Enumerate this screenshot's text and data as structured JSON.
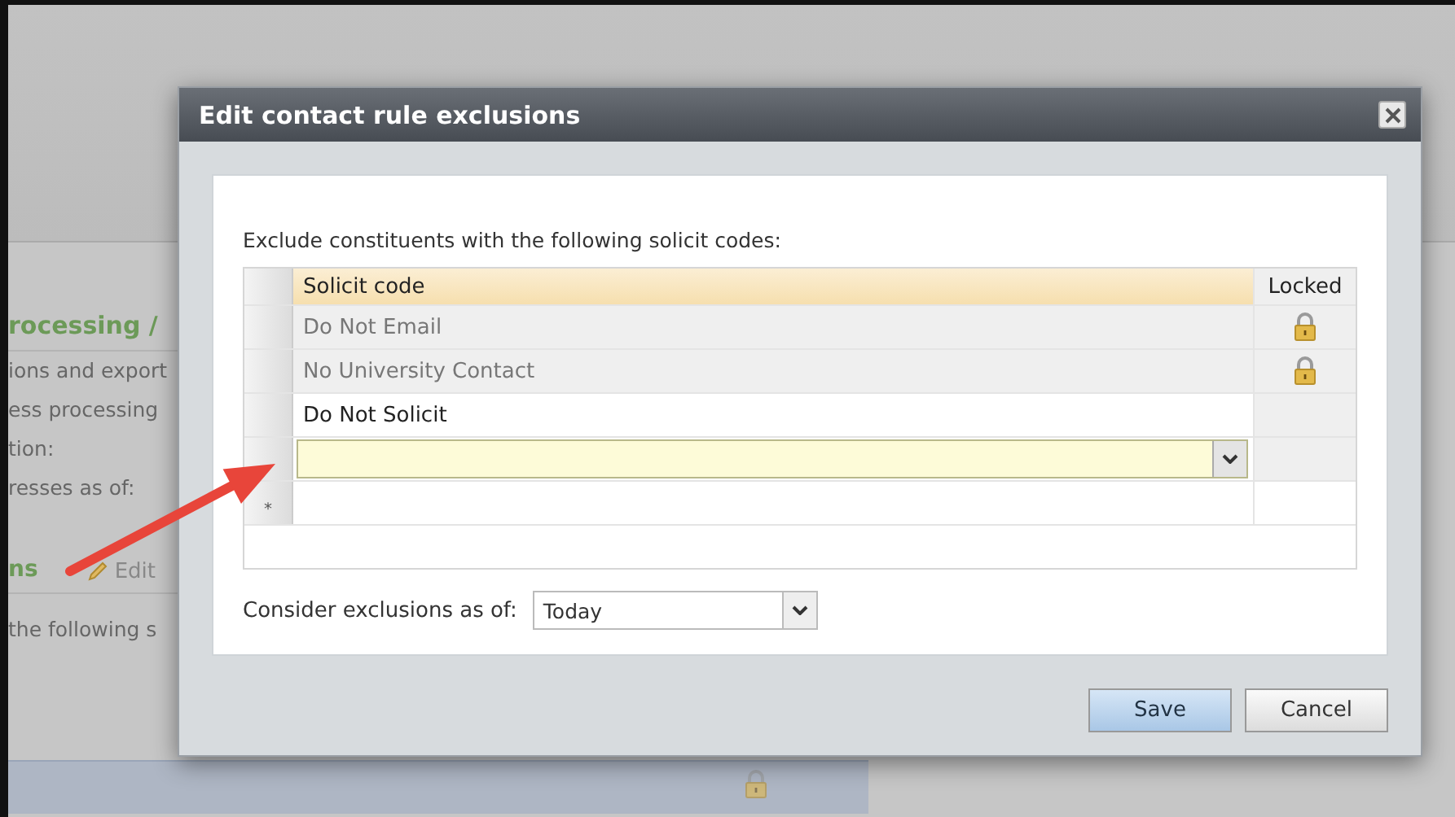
{
  "background": {
    "heading": "rocessing /",
    "lines": [
      "ions and export",
      "ess processing",
      "tion:",
      "resses as of:"
    ],
    "section_title": "ns",
    "edit_link": "Edit",
    "note": "the following s",
    "locked_row": {
      "locked": true
    }
  },
  "dialog": {
    "title": "Edit contact rule exclusions",
    "intro": "Exclude constituents with the following solicit codes:",
    "columns": [
      "Solicit code",
      "Locked"
    ],
    "rows": [
      {
        "kind": "existing",
        "code": "Do Not Email",
        "locked": true
      },
      {
        "kind": "existing",
        "code": "No University Contact",
        "locked": true
      },
      {
        "kind": "existing",
        "code": "Do Not Solicit",
        "locked": false
      },
      {
        "kind": "editing",
        "locked": false
      },
      {
        "kind": "new",
        "marker": "*",
        "locked": false
      }
    ],
    "as_of_label": "Consider exclusions as of:",
    "as_of_value": "Today",
    "buttons": [
      {
        "label": "Save",
        "primary": true
      },
      {
        "label": "Cancel",
        "primary": false
      }
    ]
  }
}
